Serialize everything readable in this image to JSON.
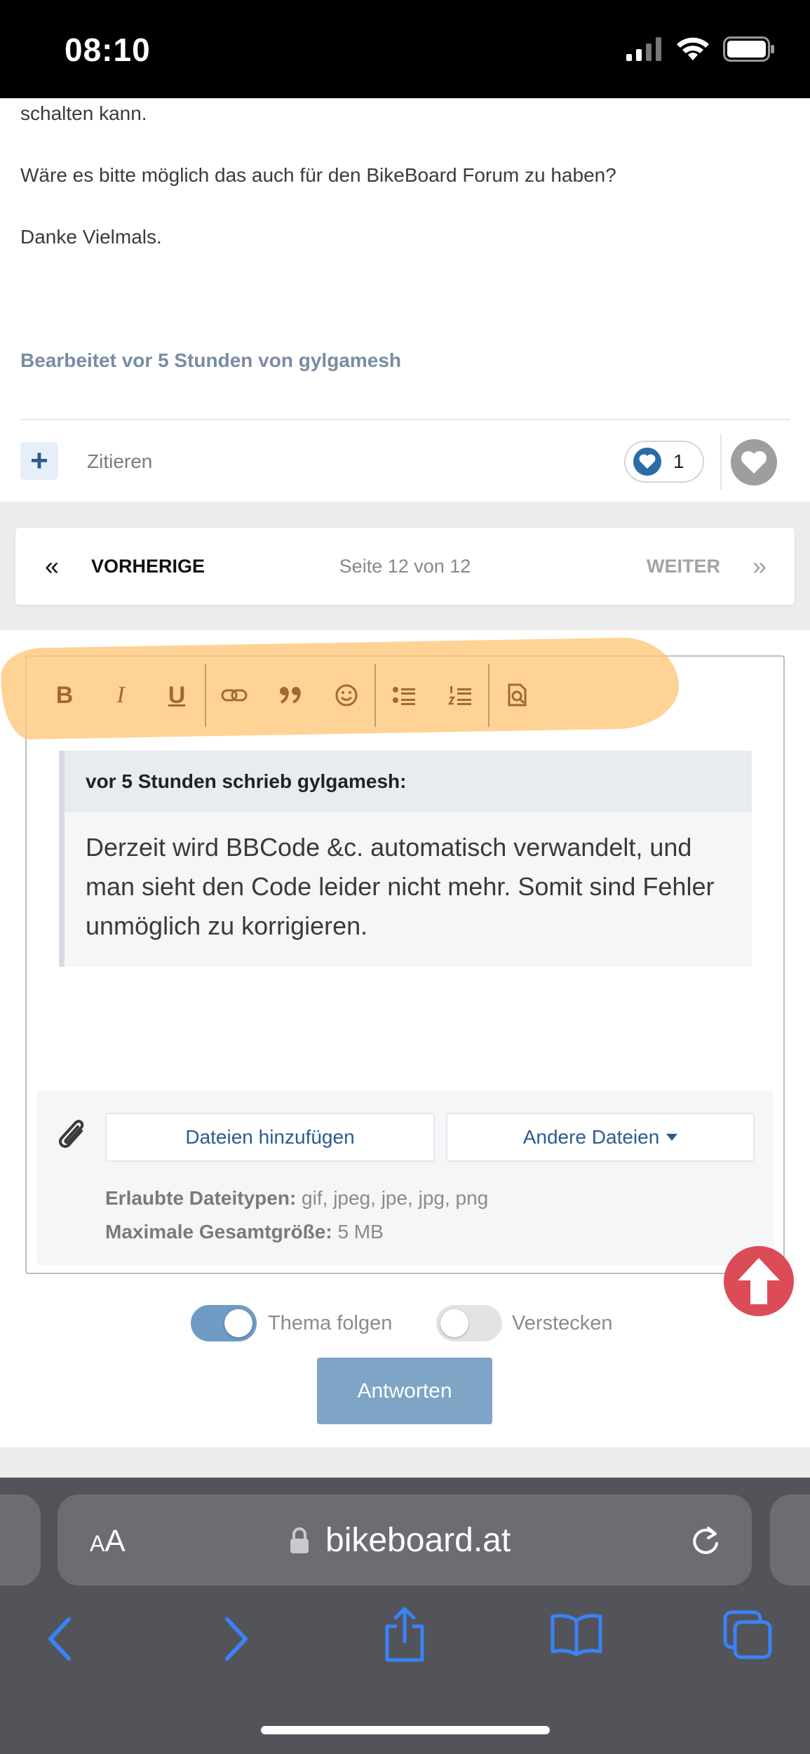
{
  "status_bar": {
    "time": "08:10"
  },
  "post": {
    "line1": "schalten kann.",
    "line2": "Wäre es bitte möglich das auch für den BikeBoard Forum zu haben?",
    "line3": "Danke Vielmals.",
    "edited": "Bearbeitet vor 5 Stunden von gylgamesh",
    "plus_label": "+",
    "quote_label": "Zitieren",
    "like_count": "1"
  },
  "pagination": {
    "prev_arrow": "«",
    "prev": "VORHERIGE",
    "info": "Seite 12 von 12",
    "next": "WEITER",
    "next_arrow": "»"
  },
  "editor": {
    "toolbar": {
      "bold": "B",
      "italic": "I",
      "underline": "U"
    },
    "quote": {
      "header": "vor 5 Stunden schrieb gylgamesh:",
      "body": "Derzeit wird BBCode &c. automatisch verwandelt, und man sieht den Code leider nicht mehr. Somit sind Fehler unmöglich zu korrigieren."
    },
    "attachments": {
      "add_files": "Dateien hinzufügen",
      "other_files": "Andere Dateien",
      "allowed_label": "Erlaubte Dateitypen:",
      "allowed_value": " gif, jpeg, jpe, jpg, png",
      "max_label": "Maximale Gesamtgröße:",
      "max_value": " 5 MB"
    }
  },
  "options": {
    "follow_label": "Thema folgen",
    "follow_on": true,
    "hide_label": "Verstecken",
    "hide_on": false,
    "submit": "Antworten"
  },
  "browser": {
    "aa_small": "A",
    "aa_big": "A",
    "domain": "bikeboard.at"
  },
  "colors": {
    "accent": "#2a5c8f",
    "highlight": "#ffc777",
    "scroll_top": "#dc4c56",
    "submit": "#7ea4c6",
    "ios_blue": "#3a82f7"
  }
}
